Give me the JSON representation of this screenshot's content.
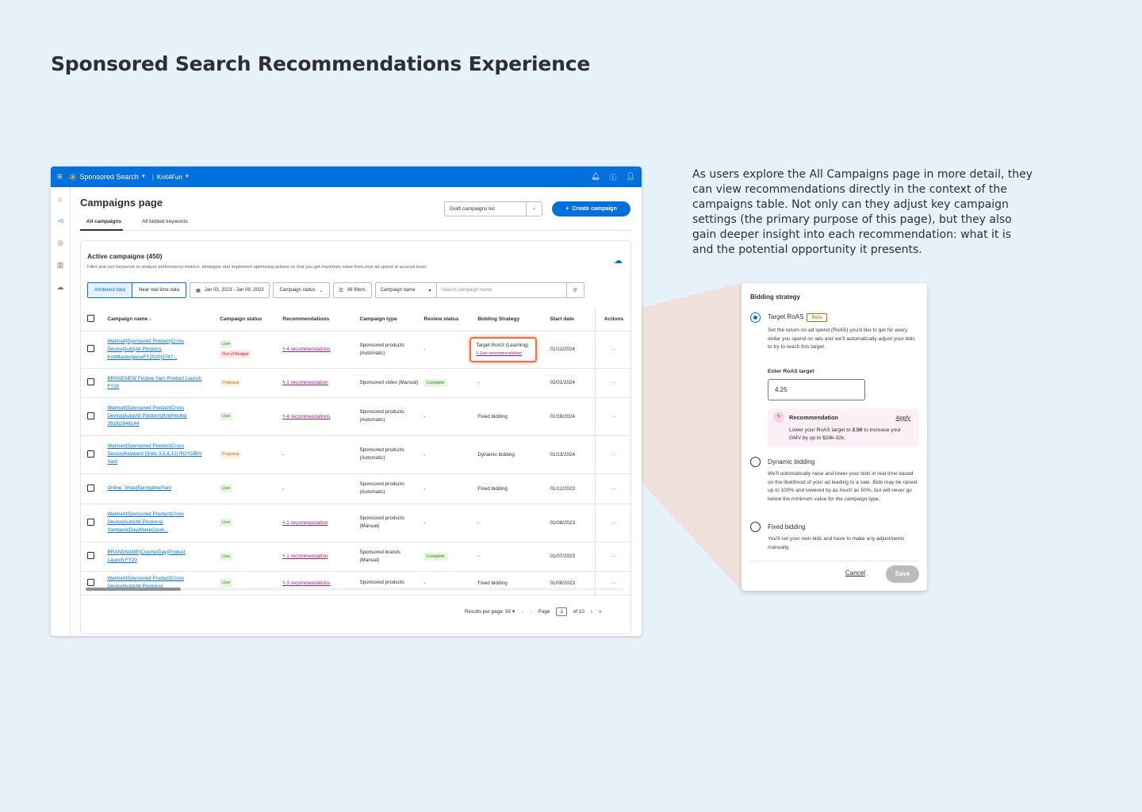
{
  "heading": "Sponsored Search Recommendations Experience",
  "description": "As users explore the All Campaigns page in more detail, they can view recommendations directly in the context of the campaigns table. Not only can they adjust key campaign settings (the primary purpose of this page), but they also gain deeper insight into each recommendation: what it is and the potential opportunity it presents.",
  "colors": {
    "brand": "#0071dc",
    "accent_spark": "#ffc220",
    "recommendation": "#a3227f",
    "highlight": "#ff6b3d"
  },
  "topbar": {
    "product": "Sponsored Search",
    "account": "Knit4Fun"
  },
  "page": {
    "title": "Campaigns page",
    "tabs": [
      "All campaigns",
      "All bidded keywords"
    ],
    "draft_select": "Draft campaigns list",
    "create_button": "Create campaign"
  },
  "card": {
    "title": "Active campaigns (450)",
    "subtitle": "Filter and sort keywords to analyze performance metrics, strategize and implement optimizing actions so that you get maximum value from your ad spend at account level.",
    "filters": {
      "attributed": "Attributed data",
      "near_real_time": "Near real time data",
      "date_range": "Jan 03, 2023 - Jan 09, 2023",
      "campaign_status": "Campaign status",
      "all_filters": "All filters",
      "search_field": "Campaign name",
      "search_placeholder": "Search campaign name"
    },
    "columns": [
      "Campaign name",
      "Campaign status",
      "Recommendations",
      "Campaign type",
      "Review status",
      "Bidding Strategy",
      "Start date",
      "Actions"
    ],
    "rows": [
      {
        "name": "Walmart|Sponsored Product|Cross Device|Auto|All Postions KnitMasterpieceFY2020|3747...",
        "status": [
          "Live",
          "Out of Budget"
        ],
        "rec": "4 recommendations",
        "type": "Sponsored products (Automatic)",
        "review": "-",
        "bidding": "Target RoAS (Learning)",
        "bidding_link": "See recommendation",
        "start": "01/12/2024"
      },
      {
        "name": "BRANDNEW Festive Yarn Product Launch FY20",
        "status": [
          "Proposal"
        ],
        "rec": "1 recommendation",
        "type": "Sponsored video (Manual)",
        "review": "Complete",
        "bidding": "-",
        "start": "02/01/2024"
      },
      {
        "name": "Walmart|Sponsored Product|Cross Device|Auto|All Postions|KnitHooks| 3918|2846144",
        "status": [
          "Live"
        ],
        "rec": "4 recommendations",
        "type": "Sponsored products (Automatic)",
        "review": "-",
        "bidding": "Fixed bidding",
        "start": "01/18/2024"
      },
      {
        "name": "Walmart|Sponsored Product|Cross Device|Keyword |Slots 3,5,6,12| ROYGBIV Yarn",
        "status": [
          "Proposal"
        ],
        "rec": "-",
        "type": "Sponsored products (Automatic)",
        "review": "-",
        "bidding": "Dynamic bidding",
        "start": "01/13/2024"
      },
      {
        "name": "Online_Shop|SpringtimeYarn",
        "status": [
          "Live"
        ],
        "rec": "-",
        "type": "Sponsored products (Automatic)",
        "review": "-",
        "bidding": "Fixed bidding",
        "start": "01/12/2023"
      },
      {
        "name": "Walmart|Sponsored Product|Cross Device|Auto|All Postions| YarntasticDay|MakeGood...",
        "status": [
          "Live"
        ],
        "rec": "1 recommendation",
        "type": "Sponsored products (Manual)",
        "review": "-",
        "bidding": "-",
        "start": "01/08/2023"
      },
      {
        "name": "BRANDNAME|CrochetDay|Product Launch FY20",
        "status": [
          "Live"
        ],
        "rec": "1 recommendation",
        "type": "Sponsored brands (Manual)",
        "review": "Complete",
        "bidding": "-",
        "start": "01/07/2023"
      },
      {
        "name": "Walmart|Sponsored Product|Cross Device|Auto|All Postions|",
        "status": [
          "Live"
        ],
        "rec": "3 recommendations",
        "type": "Sponsored products",
        "review": "-",
        "bidding": "Fixed bidding",
        "start": "01/06/2023"
      }
    ],
    "actions_label": "···",
    "pager": {
      "per_page": "Results per page: 50",
      "page_label": "Page",
      "page": "1",
      "of": "of 10"
    }
  },
  "panel": {
    "title": "Bidding strategy",
    "options": [
      {
        "label": "Target RoAS",
        "badge": "Beta",
        "desc": "Set the return on ad spend (RoAS) you'd like to get for every dollar you spend on ads and we'll automatically adjust your bids to try to reach this target."
      },
      {
        "label": "Dynamic bidding",
        "desc": "We'll automatically raise and lower your bids in real time based on the likelihood of your ad leading to a sale. Bids may be raised up to 100% and lowered by as much as 50%, but will never go below the minimum value for the campaign type."
      },
      {
        "label": "Fixed bidding",
        "desc": "You'll set your own bids and have to make any adjustments manually."
      }
    ],
    "roas_label": "Enter RoAS target",
    "roas_value": "4.25",
    "recommendation": {
      "title": "Recommendation",
      "apply": "Apply",
      "text_pre": "Lower your RoAS target to ",
      "text_value": "2.50",
      "text_post": " to increase your GMV by up to $28k-32k."
    },
    "cancel": "Cancel",
    "save": "Save"
  }
}
